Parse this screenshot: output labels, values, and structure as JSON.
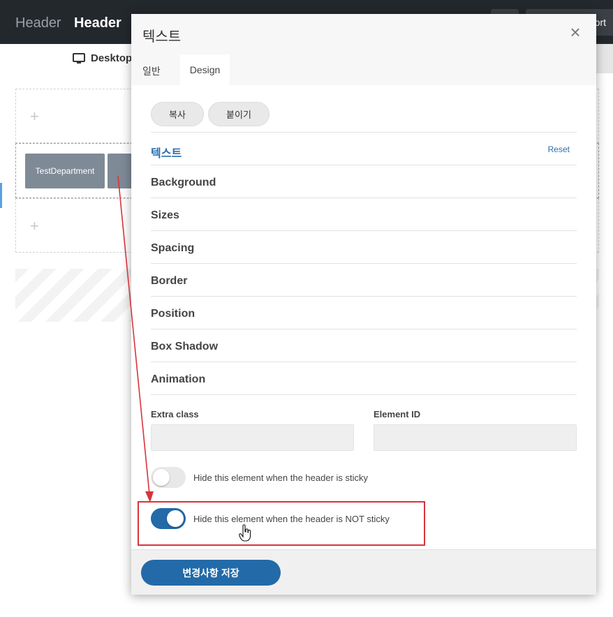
{
  "topbar": {
    "title_inactive": "Header",
    "title_active": "Header",
    "right_button_label": "ort"
  },
  "device": {
    "label": "Desktop"
  },
  "builder": {
    "element_chip": "TestDepartment"
  },
  "modal": {
    "title": "텍스트",
    "tabs": [
      {
        "label": "일반",
        "active": false
      },
      {
        "label": "Design",
        "active": true
      }
    ],
    "buttons": {
      "copy": "복사",
      "paste": "붙이기"
    },
    "sections": [
      {
        "label": "텍스트",
        "active": true,
        "reset": "Reset"
      },
      {
        "label": "Background"
      },
      {
        "label": "Sizes"
      },
      {
        "label": "Spacing"
      },
      {
        "label": "Border"
      },
      {
        "label": "Position"
      },
      {
        "label": "Box Shadow"
      },
      {
        "label": "Animation"
      }
    ],
    "fields": {
      "extra_class": {
        "label": "Extra class",
        "value": ""
      },
      "element_id": {
        "label": "Element ID",
        "value": ""
      }
    },
    "toggles": [
      {
        "label": "Hide this element when the header is sticky",
        "on": false
      },
      {
        "label": "Hide this element when the header is NOT sticky",
        "on": true
      }
    ],
    "save_label": "변경사항 저장"
  },
  "colors": {
    "accent": "#236aa8",
    "annotation": "#d8343a",
    "topbar": "#23282d"
  }
}
